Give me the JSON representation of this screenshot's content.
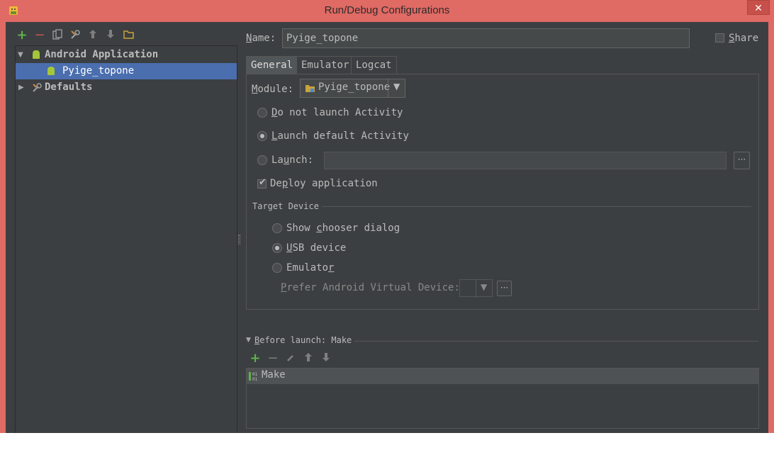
{
  "window": {
    "title": "Run/Debug Configurations",
    "close_label": "✕",
    "app_icon": "android-icon"
  },
  "left_toolbar": {
    "icons": [
      "add-icon",
      "remove-icon",
      "copy-icon",
      "edit-defaults-icon",
      "move-up-icon",
      "move-down-icon",
      "folder-icon"
    ],
    "add": "+",
    "remove": "−",
    "up": "🡑",
    "down": "🡓"
  },
  "tree": {
    "items": [
      {
        "label": "Android Application",
        "expanded": true,
        "icon": "android-icon"
      },
      {
        "label": "Pyige_topone",
        "selected": true,
        "icon": "android-icon"
      },
      {
        "label": "Defaults",
        "expanded": false,
        "icon": "wrench-icon"
      }
    ]
  },
  "name": {
    "label_u": "N",
    "label_rest": "ame:",
    "value": "Pyige_topone"
  },
  "share": {
    "label_u": "S",
    "label_rest": "hare",
    "checked": false
  },
  "tabs": [
    {
      "label": "General",
      "active": true
    },
    {
      "label": "Emulator",
      "active": false
    },
    {
      "label": "Logcat",
      "active": false
    }
  ],
  "general": {
    "module_label_u": "M",
    "module_label_rest": "odule:",
    "module_value": "Pyige_topone",
    "launch_options": [
      {
        "u": "D",
        "rest": "o not launch Activity",
        "selected": false
      },
      {
        "u": "L",
        "rest": "aunch default Activity",
        "selected": true
      },
      {
        "pre": "La",
        "u": "u",
        "rest": "nch:",
        "selected": false
      }
    ],
    "launch_value": "",
    "ellipsis": "···",
    "deploy_pre": "De",
    "deploy_u": "p",
    "deploy_rest": "loy application",
    "deploy_checked": true,
    "target_device_title": "Target Device",
    "target_options": [
      {
        "pre": "Show ",
        "u": "c",
        "rest": "hooser dialog",
        "selected": false
      },
      {
        "pre": "",
        "u": "U",
        "rest": "SB device",
        "selected": true
      },
      {
        "pre": "Emulato",
        "u": "r",
        "rest": "",
        "selected": false
      }
    ],
    "avd_u": "P",
    "avd_rest": "refer Android Virtual Device:",
    "avd_value": ""
  },
  "before_launch": {
    "title_u": "B",
    "title_rest": "efore launch: Make",
    "toolbar_icons": [
      "add-icon",
      "remove-icon",
      "edit-icon",
      "move-up-icon",
      "move-down-icon"
    ],
    "tasks": [
      {
        "label": "Make",
        "icon": "make-icon"
      }
    ]
  },
  "colors": {
    "frame": "#e06a64",
    "background": "#3c3f41",
    "selection": "#4b6eaf",
    "add_green": "#5fb34b",
    "remove_red": "#c75450",
    "android_green": "#a4c639"
  }
}
